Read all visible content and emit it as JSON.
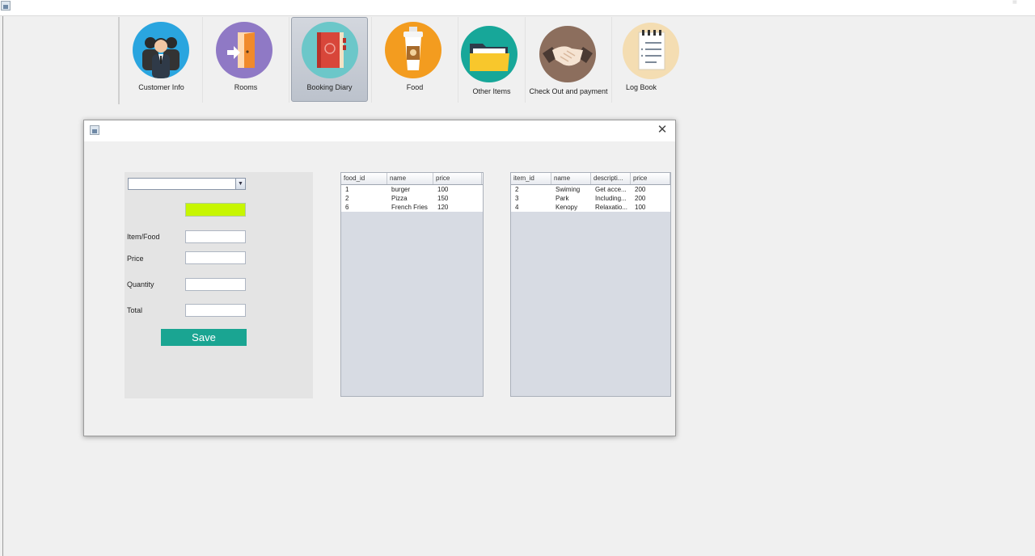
{
  "toolbar": {
    "items": [
      {
        "label": "Customer Info"
      },
      {
        "label": "Rooms"
      },
      {
        "label": "Booking Diary"
      },
      {
        "label": "Food"
      },
      {
        "label": "Other Items"
      },
      {
        "label": "Check Out and payment"
      },
      {
        "label": "Log Book"
      }
    ],
    "selected": "Booking Diary"
  },
  "form": {
    "combo_value": "",
    "labels": {
      "item": "Item/Food",
      "price": "Price",
      "quantity": "Quantity",
      "total": "Total"
    },
    "values": {
      "item": "",
      "price": "",
      "quantity": "",
      "total": ""
    },
    "save_label": "Save",
    "indicator_color": "#c7f600"
  },
  "food_table": {
    "columns": [
      "food_id",
      "name",
      "price"
    ],
    "rows": [
      [
        "1",
        "burger",
        "100"
      ],
      [
        "2",
        "Pizza",
        "150"
      ],
      [
        "6",
        "French Fries",
        "120"
      ]
    ]
  },
  "items_table": {
    "columns": [
      "item_id",
      "name",
      "descripti...",
      "price"
    ],
    "rows": [
      [
        "2",
        "Swiming",
        "Get acce...",
        "200"
      ],
      [
        "3",
        "Park",
        "Including...",
        "200"
      ],
      [
        "4",
        "Kenopy",
        "Relaxatio...",
        "100"
      ]
    ]
  },
  "colors": {
    "save_button": "#1aa592",
    "table_background": "#d7dbe3"
  }
}
